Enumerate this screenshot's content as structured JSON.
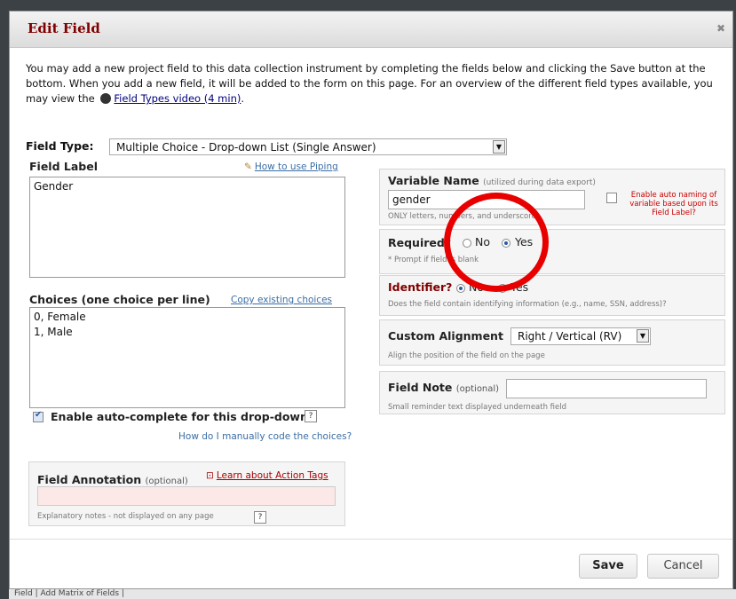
{
  "dialog": {
    "title": "Edit Field",
    "close_glyph": "✖",
    "intro_text_1": "You may add a new project field to this data collection instrument by completing the fields below and clicking the Save button at the bottom. When you add a new field, it will be added to the form on this page. For an overview of the different field types available, you may view the",
    "intro_link": "Field Types video (4 min)",
    "intro_end": "."
  },
  "field_type": {
    "label": "Field Type:",
    "value": "Multiple Choice - Drop-down List (Single Answer)"
  },
  "field_label": {
    "label": "Field Label",
    "piping_link": "How to use Piping",
    "value": "Gender"
  },
  "choices": {
    "label": "Choices (one choice per line)",
    "copy_link": "Copy existing choices",
    "lines": [
      "0, Female",
      "1, Male"
    ],
    "autocomplete_label": "Enable auto-complete for this drop-down",
    "help_glyph": "?",
    "manual_code_link": "How do I manually code the choices?"
  },
  "annotation": {
    "label": "Field Annotation",
    "optional": "(optional)",
    "action_tags_link": "Learn about Action Tags",
    "value": "",
    "note": "Explanatory notes - not displayed on any page",
    "help_glyph": "?"
  },
  "variable": {
    "label": "Variable Name",
    "sub": "(utilized during data export)",
    "value": "gender",
    "hint": "ONLY letters, numbers, and underscores",
    "auto_naming": "Enable auto naming of variable based upon its Field Label?"
  },
  "required": {
    "label": "Required?",
    "no": "No",
    "yes": "Yes",
    "hint": "* Prompt if field is blank",
    "selected": "Yes"
  },
  "identifier": {
    "label": "Identifier?",
    "no": "No",
    "yes": "Yes",
    "hint": "Does the field contain identifying information (e.g., name, SSN, address)?",
    "selected": "No"
  },
  "alignment": {
    "label": "Custom Alignment",
    "value": "Right / Vertical (RV)",
    "hint": "Align the position of the field on the page"
  },
  "field_note": {
    "label": "Field Note",
    "optional": "(optional)",
    "value": "",
    "hint": "Small reminder text displayed underneath field"
  },
  "buttons": {
    "save": "Save",
    "cancel": "Cancel"
  },
  "background": {
    "bottom_text": "Field  |  Add Matrix of Fields  |"
  },
  "colors": {
    "title": "#800000",
    "annotation": "#e80000",
    "link": "#3a6ea5",
    "identifier_label": "#800000"
  }
}
